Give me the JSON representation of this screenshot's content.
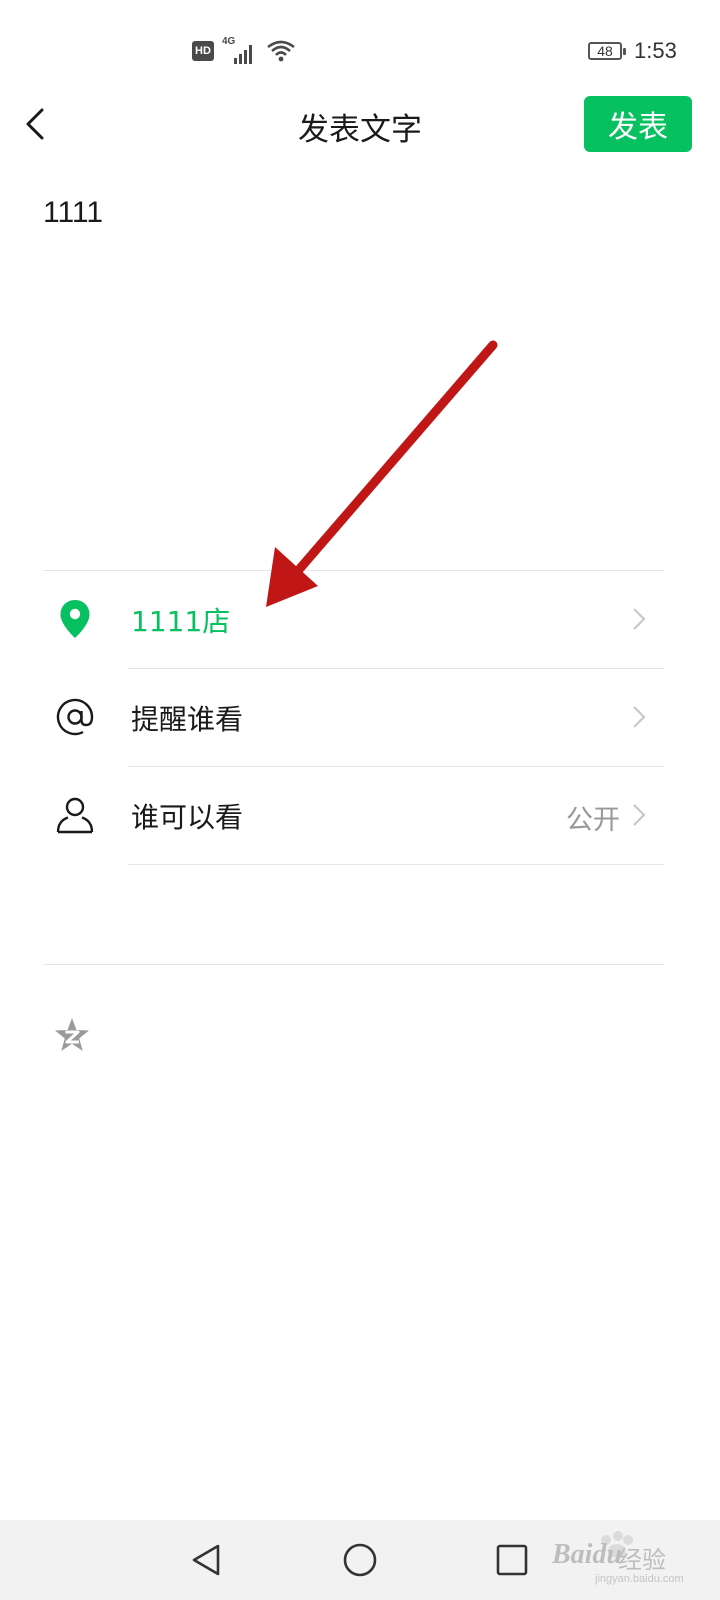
{
  "status_bar": {
    "network_badge": "HD",
    "network_type": "4G",
    "battery_level": "48",
    "time": "1:53",
    "icons": [
      "hd-icon",
      "cellular-signal-icon",
      "wifi-icon",
      "battery-icon"
    ]
  },
  "header": {
    "back_icon": "chevron-left-icon",
    "title": "发表文字",
    "publish_label": "发表"
  },
  "composer": {
    "text": "1111"
  },
  "options": {
    "location": {
      "label": "1111店",
      "icon": "location-pin-icon",
      "color": "#07c160"
    },
    "mention": {
      "label": "提醒谁看",
      "icon": "at-icon"
    },
    "visibility": {
      "label": "谁可以看",
      "value": "公开",
      "icon": "person-icon"
    }
  },
  "extras": {
    "qzone_icon": "qzone-star-icon"
  },
  "nav_bar": {
    "buttons": [
      "nav-back-icon",
      "nav-home-icon",
      "nav-recents-icon"
    ]
  },
  "watermark": {
    "brand": "Bai",
    "brand2": "du",
    "label": "经验",
    "url": "jingyan.baidu.com"
  },
  "colors": {
    "accent": "#07c160",
    "annotation_arrow": "#c01616",
    "divider": "#e6e6e6",
    "secondary_text": "#999999"
  }
}
